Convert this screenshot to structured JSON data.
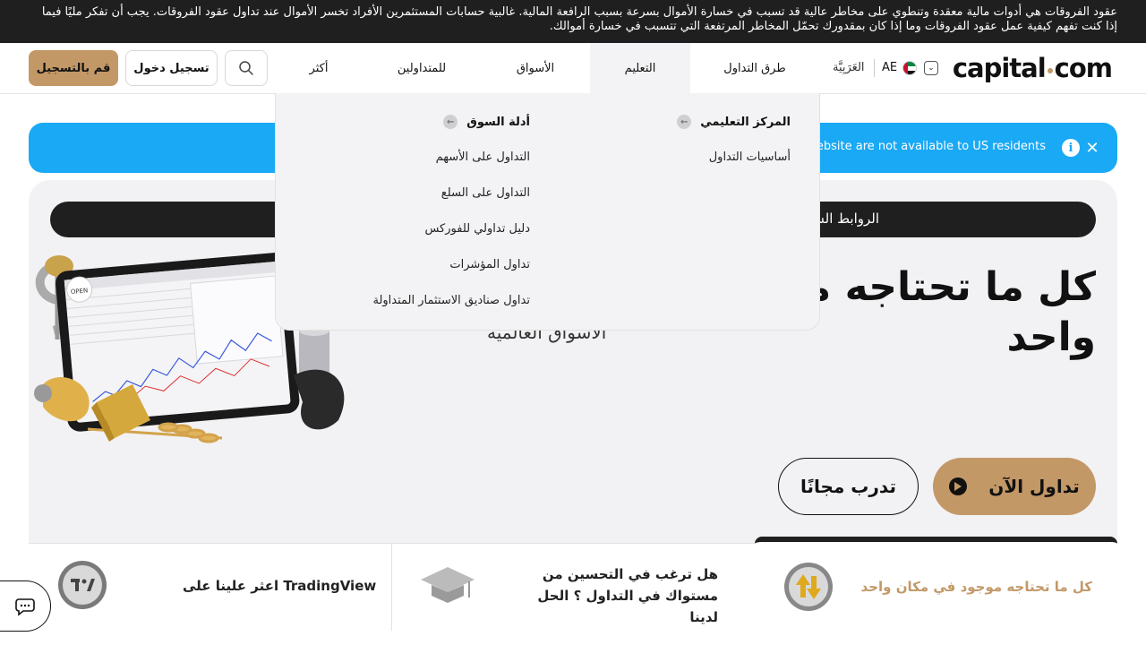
{
  "risk_warning": "عقود الفروقات هي أدوات مالية معقدة وتنطوي على مخاطر عالية قد تسبب في خسارة الأموال بسرعة بسبب الرافعة المالية. غالبية حسابات المستثمرين الأفراد تخسر الأموال عند تداول عقود الفروقات. يجب أن تفكر مليًا فيما إذا كنت تفهم كيفية عمل عقود الفروقات وما إذا كان بمقدورك تحمّل المخاطر المرتفعة التي تتسبب في خسارة أموالك.",
  "header": {
    "logo_left": "capital",
    "logo_right": "com",
    "region_code": "AE",
    "language": "العَرَبِيَّة",
    "nav": [
      {
        "label": "طرق التداول"
      },
      {
        "label": "التعليم"
      },
      {
        "label": "الأسواق"
      },
      {
        "label": "للمتداولين"
      },
      {
        "label": "أكثر"
      }
    ],
    "login_label": "تسجيل دخول",
    "signup_label": "قم بالتسجيل"
  },
  "notice": {
    "text": "s website are not available to US residents",
    "info_glyph": "i",
    "close_glyph": "✕"
  },
  "hero": {
    "quicklinks_label": "الروابط الس",
    "quicklinks_q": "؟",
    "headline": "كل ما تحتاجه مو مكان واحد",
    "subline": "الأسواق العالمية",
    "trade_now_label": "تداول الآن",
    "practice_label": "تدرب مجانًا",
    "illus_screen_badge": "OPEN"
  },
  "strip": [
    {
      "title": "كل ما تحتاجه موجود في مكان واحد",
      "accent": "#c39867"
    },
    {
      "title": "هل ترغب في التحسين من مستواك في التداول ؟ الحل لدينا"
    },
    {
      "title": "اعثر علينا على TradingView"
    }
  ],
  "dropdown": {
    "col1_head": "المركز التعليمي",
    "col1_links": [
      "أساسيات التداول"
    ],
    "col2_head": "أدلة السوق",
    "col2_links": [
      "التداول على الأسهم",
      "التداول على السلع",
      "دليل تداولي للفوركس",
      "تداول المؤشرات",
      "تداول صناديق الاستثمار المتداولة"
    ]
  },
  "colors": {
    "accent": "#c39867",
    "notice_blue": "#1aa9f5",
    "dark": "#1f1f1f"
  }
}
